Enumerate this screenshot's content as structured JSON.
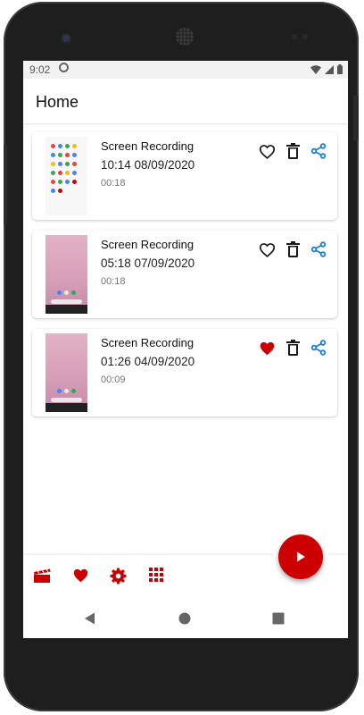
{
  "status_bar": {
    "time": "9:02"
  },
  "app_bar": {
    "title": "Home"
  },
  "recordings": [
    {
      "title": "Screen Recording",
      "datetime": "10:14 08/09/2020",
      "duration": "00:18",
      "favorite": false,
      "thumbnail": "app-drawer"
    },
    {
      "title": "Screen Recording",
      "datetime": "05:18 07/09/2020",
      "duration": "00:18",
      "favorite": false,
      "thumbnail": "pink-home"
    },
    {
      "title": "Screen Recording",
      "datetime": "01:26 04/09/2020",
      "duration": "00:09",
      "favorite": true,
      "thumbnail": "pink-home"
    }
  ],
  "card_icons": [
    "heart-icon",
    "trash-icon",
    "share-icon"
  ],
  "bottom_nav": [
    "clapperboard-icon",
    "heart-icon",
    "gear-icon",
    "grid-icon"
  ],
  "fab": {
    "icon": "play-icon"
  },
  "system_nav": [
    "back-icon",
    "home-icon",
    "recents-icon"
  ],
  "colors": {
    "accent": "#cc0000",
    "share": "#1a7fd6",
    "icon": "#1a1a1a"
  }
}
